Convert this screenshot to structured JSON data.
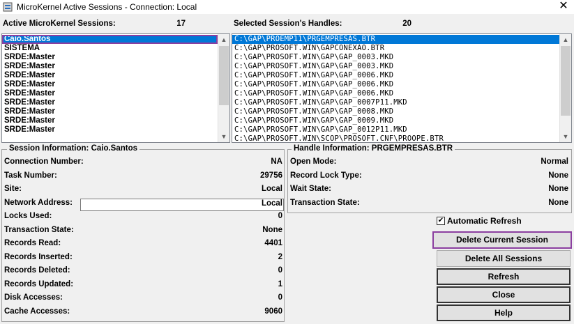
{
  "window": {
    "title": "MicroKernel Active Sessions  -  Connection: Local",
    "close_glyph": "✕"
  },
  "sessions": {
    "label": "Active MicroKernel Sessions:",
    "count": "17",
    "items": [
      "Caio.Santos",
      "SISTEMA",
      "SRDE:Master",
      "SRDE:Master",
      "SRDE:Master",
      "SRDE:Master",
      "SRDE:Master",
      "SRDE:Master",
      "SRDE:Master",
      "SRDE:Master",
      "SRDE:Master"
    ],
    "selected_index": 0
  },
  "handles": {
    "label": "Selected Session's Handles:",
    "count": "20",
    "items": [
      "C:\\GAP\\PROEMP11\\PRGEMPRESAS.BTR",
      "C:\\GAP\\PROSOFT.WIN\\GAPCONEXAO.BTR",
      "C:\\GAP\\PROSOFT.WIN\\GAP\\GAP_0003.MKD",
      "C:\\GAP\\PROSOFT.WIN\\GAP\\GAP_0003.MKD",
      "C:\\GAP\\PROSOFT.WIN\\GAP\\GAP_0006.MKD",
      "C:\\GAP\\PROSOFT.WIN\\GAP\\GAP_0006.MKD",
      "C:\\GAP\\PROSOFT.WIN\\GAP\\GAP_0006.MKD",
      "C:\\GAP\\PROSOFT.WIN\\GAP\\GAP_0007P11.MKD",
      "C:\\GAP\\PROSOFT.WIN\\GAP\\GAP_0008.MKD",
      "C:\\GAP\\PROSOFT.WIN\\GAP\\GAP_0009.MKD",
      "C:\\GAP\\PROSOFT.WIN\\GAP\\GAP_0012P11.MKD",
      "C:\\GAP\\PROSOFT.WIN\\SCOP\\PROSOFT.CNF\\PROOPE.BTR"
    ]
  },
  "session_info": {
    "title": "Session Information: Caio.Santos",
    "rows": [
      {
        "label": "Connection Number:",
        "value": "NA"
      },
      {
        "label": "Task Number:",
        "value": "29756"
      },
      {
        "label": "Site:",
        "value": "Local"
      },
      {
        "label": "Network Address:",
        "value": "Local"
      },
      {
        "label": "Locks Used:",
        "value": "0"
      },
      {
        "label": "Transaction State:",
        "value": "None"
      },
      {
        "label": "Records Read:",
        "value": "4401"
      },
      {
        "label": "Records Inserted:",
        "value": "2"
      },
      {
        "label": "Records Deleted:",
        "value": "0"
      },
      {
        "label": "Records Updated:",
        "value": "1"
      },
      {
        "label": "Disk Accesses:",
        "value": "0"
      },
      {
        "label": "Cache Accesses:",
        "value": "9060"
      }
    ]
  },
  "handle_info": {
    "title": "Handle Information: PRGEMPRESAS.BTR",
    "rows": [
      {
        "label": "Open Mode:",
        "value": "Normal"
      },
      {
        "label": "Record Lock Type:",
        "value": "None"
      },
      {
        "label": "Wait State:",
        "value": "None"
      },
      {
        "label": "Transaction State:",
        "value": "None"
      }
    ]
  },
  "controls": {
    "auto_refresh_label": "Automatic Refresh",
    "auto_refresh_checked": true,
    "buttons": {
      "delete_current": "Delete Current Session",
      "delete_all": "Delete All Sessions",
      "refresh": "Refresh",
      "close": "Close",
      "help": "Help"
    }
  },
  "colors": {
    "selection": "#0078d7",
    "highlight_outline": "#8b3fa0"
  }
}
